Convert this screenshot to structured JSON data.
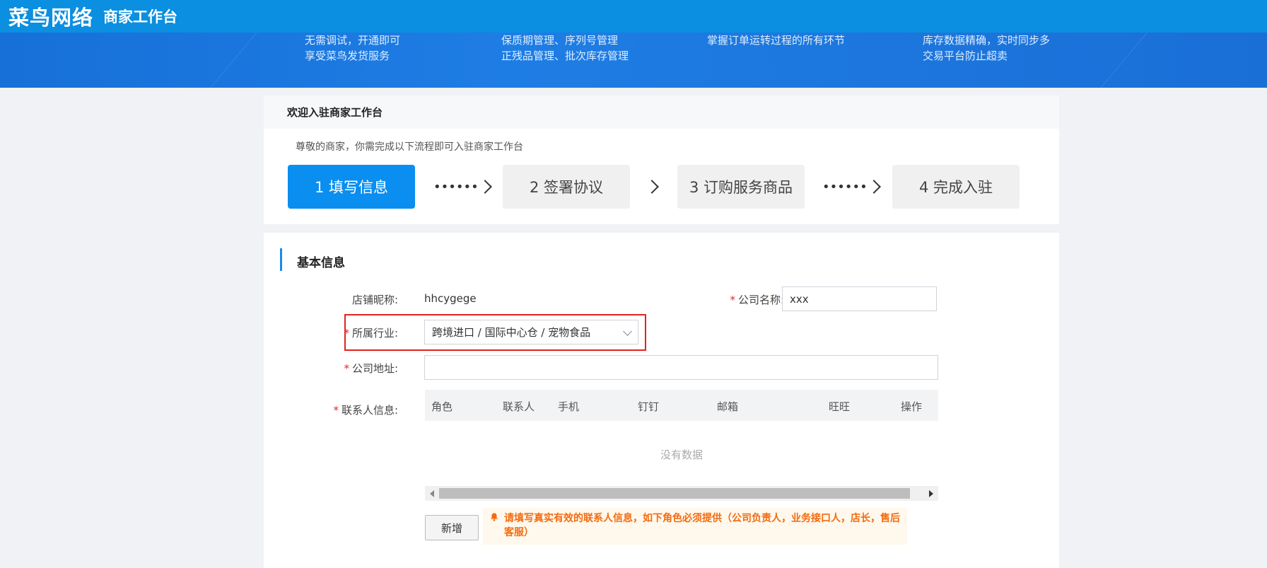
{
  "header": {
    "logo": "菜鸟网络",
    "app_title": "商家工作台"
  },
  "banner": {
    "features": [
      {
        "line1": "无需调试，开通即可",
        "line2": "享受菜鸟发货服务"
      },
      {
        "line1": "保质期管理、序列号管理",
        "line2": "正残品管理、批次库存管理"
      },
      {
        "line1": "掌握订单运转过程的所有环节",
        "line2": ""
      },
      {
        "line1": "库存数据精确，实时同步多",
        "line2": "交易平台防止超卖"
      }
    ]
  },
  "welcome": {
    "title": "欢迎入驻商家工作台",
    "subtitle": "尊敬的商家，你需完成以下流程即可入驻商家工作台",
    "steps": [
      {
        "label": "1 填写信息",
        "active": true
      },
      {
        "label": "2 签署协议",
        "active": false
      },
      {
        "label": "3 订购服务商品",
        "active": false
      },
      {
        "label": "4 完成入驻",
        "active": false
      }
    ],
    "connector_dots": "••••••"
  },
  "form": {
    "section_title": "基本信息",
    "store_nickname_label": "店铺昵称:",
    "store_nickname_value": "hhcygege",
    "company_name_label": "公司名称:",
    "company_name_value": "xxx",
    "industry_label": "所属行业:",
    "industry_value": "跨境进口 / 国际中心仓 / 宠物食品",
    "address_label": "公司地址:",
    "address_value": "",
    "contact_label": "联系人信息:",
    "required_mark": "*",
    "contact_table": {
      "columns": [
        "角色",
        "联系人",
        "手机",
        "钉钉",
        "邮箱",
        "旺旺",
        "操作"
      ],
      "empty_text": "没有数据"
    },
    "add_button": "新增",
    "notice": "请填写真实有效的联系人信息，如下角色必须提供（公司负责人，业务接口人，店长，售后客服）"
  },
  "colors": {
    "header_blue": "#0b8fe0",
    "active_step": "#0a8ef0",
    "required_red": "#e02a2a",
    "highlight_red": "#e0231f",
    "notice_orange": "#f36b10"
  }
}
